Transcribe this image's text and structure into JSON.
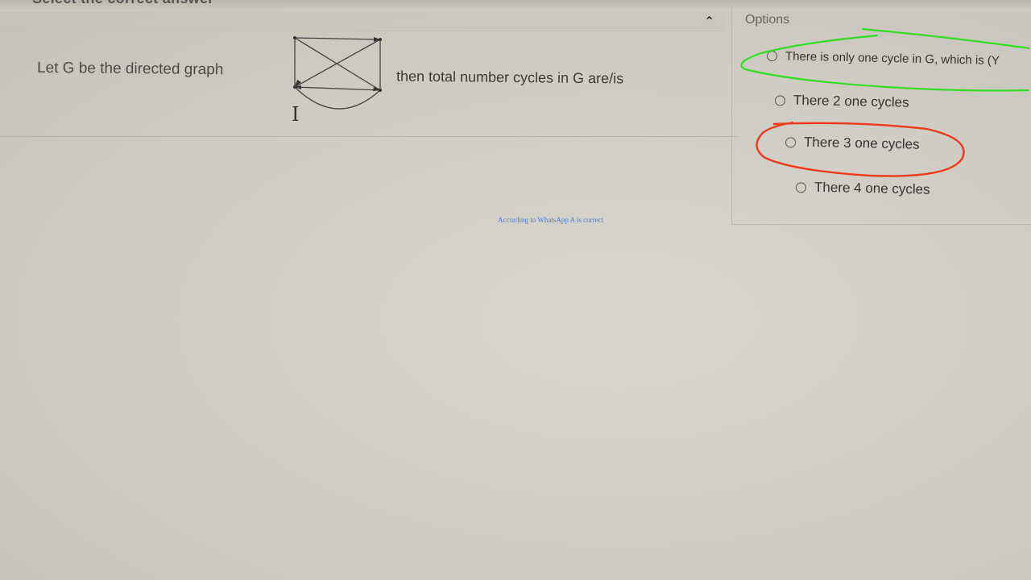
{
  "header": {
    "title": "Select the correct answer"
  },
  "question": {
    "text_before": "Let G be the directed graph",
    "text_after": "then total number cycles in G are/is"
  },
  "options_panel": {
    "title": "Options",
    "options": [
      {
        "label": "There is only one cycle in G, which is (Y"
      },
      {
        "label": "There 2 one cycles"
      },
      {
        "label": "There 3 one cycles"
      },
      {
        "label": "There 4 one cycles"
      }
    ]
  },
  "annotations": {
    "green_circle_color": "#33dd22",
    "red_circle_color": "#ee3a1a",
    "watermark_text": "According to WhatsApp A is correct",
    "watermark_color": "#4a7fd6"
  },
  "icons": {
    "collapse": "chevron-up-icon",
    "cursor": "text-cursor-icon"
  }
}
